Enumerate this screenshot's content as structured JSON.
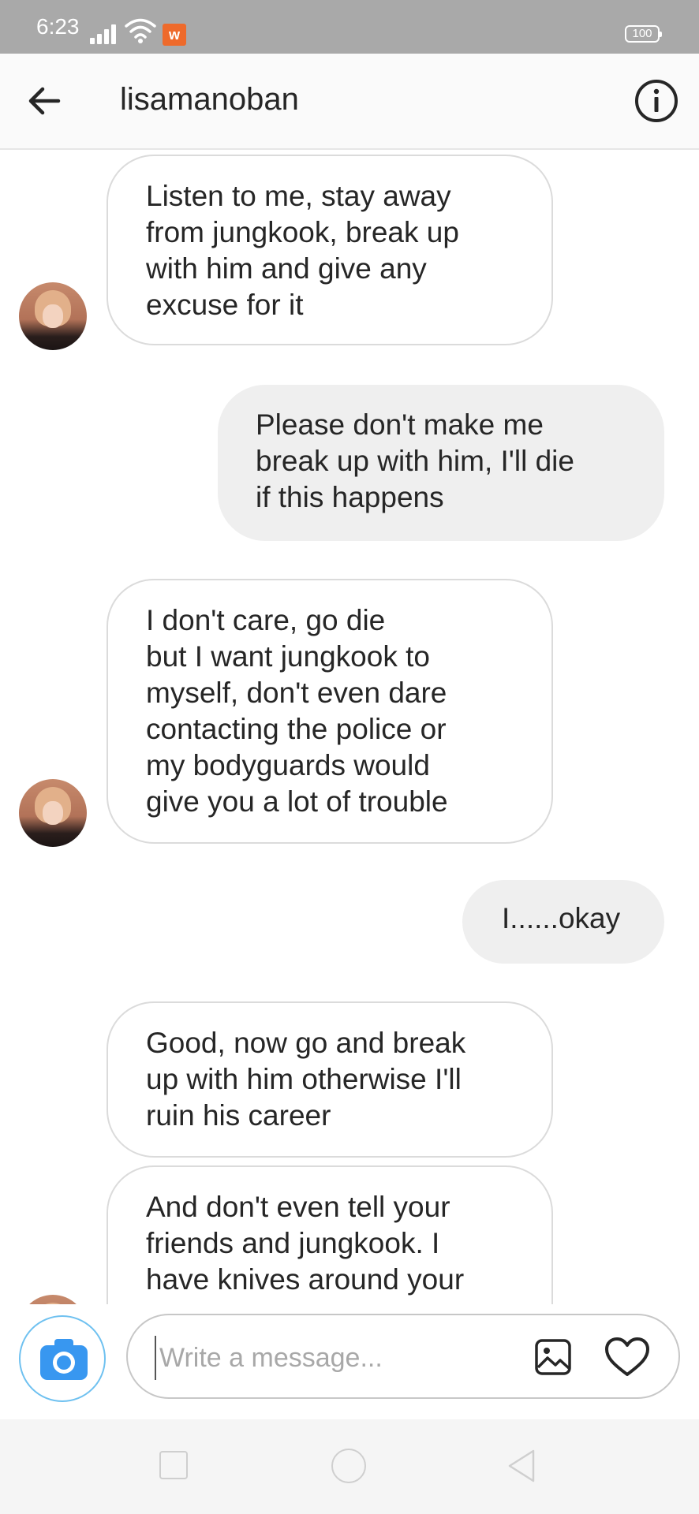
{
  "status_bar": {
    "time": "6:23",
    "battery": "100",
    "app_badge_icon": "w-app-icon"
  },
  "header": {
    "back_icon": "arrow-left-icon",
    "title": "lisamanoban",
    "info_icon": "info-circle-icon"
  },
  "messages": [
    {
      "direction": "incoming",
      "text": "Listen to me, stay away\nfrom jungkook, break up\nwith him and give any\nexcuse for it"
    },
    {
      "direction": "outgoing",
      "text": "Please don't make me\nbreak up with him, I'll die\nif this happens"
    },
    {
      "direction": "incoming",
      "text": "I don't care, go die\nbut I want jungkook to\nmyself, don't even dare\ncontacting the police or\nmy bodyguards would\ngive you a lot of trouble"
    },
    {
      "direction": "outgoing",
      "text": "I......okay"
    },
    {
      "direction": "incoming",
      "text": "Good, now go and break\nup with him otherwise I'll\nruin his career"
    },
    {
      "direction": "incoming",
      "text": "And don't even tell your\nfriends and jungkook. I\nhave knives around your"
    }
  ],
  "composer": {
    "camera_icon": "camera-icon",
    "placeholder": "Write a message...",
    "value": "",
    "gallery_icon": "image-icon",
    "heart_icon": "heart-icon"
  },
  "colors": {
    "status_bar": "#a9a9a9",
    "incoming_border": "#dbdbdb",
    "outgoing_bg": "#efefef",
    "camera_accent": "#3897f0"
  }
}
